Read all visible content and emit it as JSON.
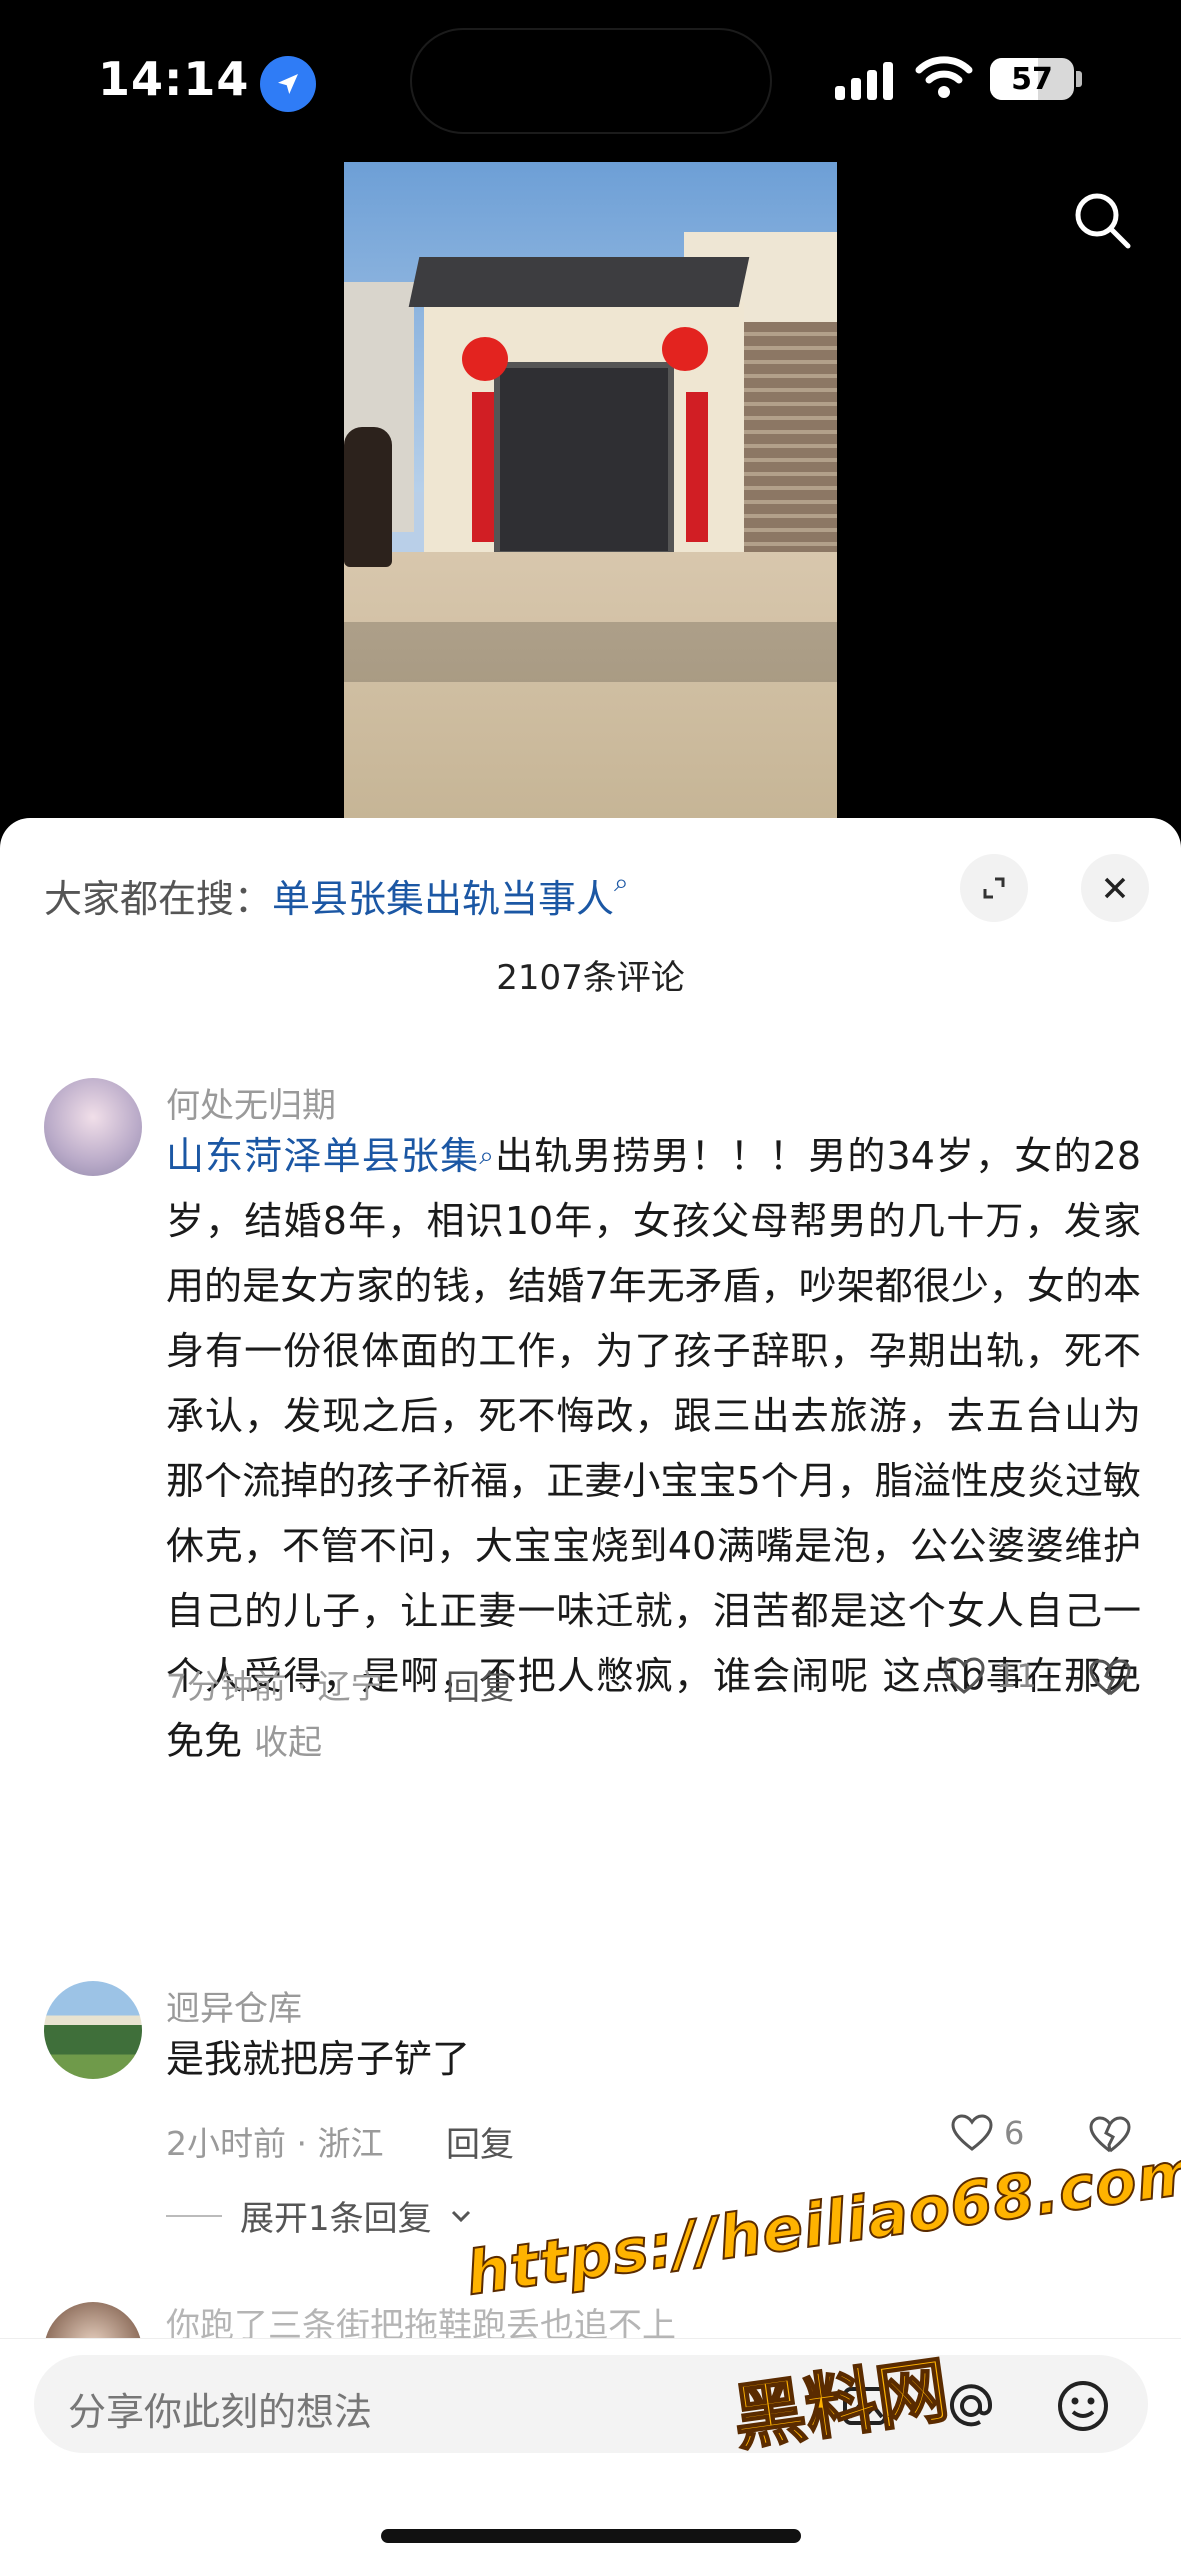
{
  "status_bar": {
    "time": "14:14",
    "battery": "57",
    "battery_level": 0.57
  },
  "hot_search": {
    "prefix": "大家都在搜：",
    "keyword": "单县张集出轨当事人",
    "search_glyph": "⌕"
  },
  "comments_count": "2107条评论",
  "comments": [
    {
      "username": "何处无归期",
      "link_text": "山东菏泽单县张集",
      "link_glyph": "⌕",
      "text": "出轨男捞男！！！男的34岁，女的28岁，结婚8年，相识10年，女孩父母帮男的几十万，发家用的是女方家的钱，结婚7年无矛盾，吵架都很少，女的本身有一份很体面的工作，为了孩子辞职，孕期出轨，死不承认，发现之后，死不悔改，跟三出去旅游，去五台山为那个流掉的孩子祈福，正妻小宝宝5个月，脂溢性皮炎过敏休克，不管不问，大宝宝烧到40满嘴是泡，公公婆婆维护自己的儿子，让正妻一味迁就，泪苦都是这个女人自己一个人受得，是啊，不把人憋疯，谁会闹呢 这点b事在那免免免",
      "fold_label": "收起",
      "meta": "7分钟前 · 辽宁",
      "reply_label": "回复",
      "likes": "11"
    },
    {
      "username": "迥异仓库",
      "text": "是我就把房子铲了",
      "meta": "2小时前 · 浙江",
      "reply_label": "回复",
      "likes": "6",
      "expand_label": "展开1条回复"
    },
    {
      "username_partial": "你跑了三条街把拖鞋跑丢也追不上"
    }
  ],
  "input": {
    "placeholder": "分享你此刻的想法"
  },
  "watermark": {
    "url": "https://heiliao68.com",
    "name": "黑料网"
  },
  "colors": {
    "link": "#1b57a4",
    "accent_watermark": "#ffb300"
  }
}
